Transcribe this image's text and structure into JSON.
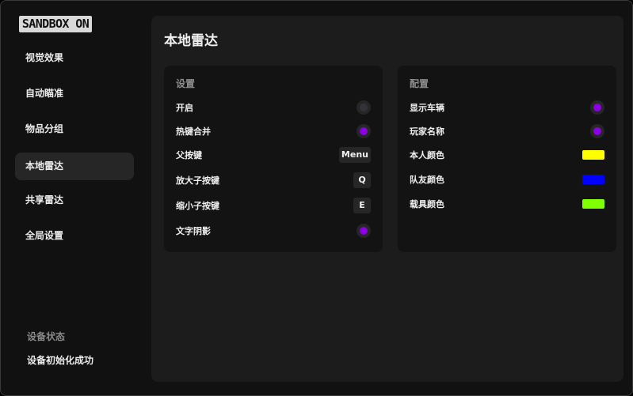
{
  "app": {
    "logo_text": "SANDBOX ON"
  },
  "sidebar": {
    "items": [
      {
        "label": "视觉效果",
        "active": false
      },
      {
        "label": "自动瞄准",
        "active": false
      },
      {
        "label": "物品分组",
        "active": false
      },
      {
        "label": "本地雷达",
        "active": true
      },
      {
        "label": "共享雷达",
        "active": false
      },
      {
        "label": "全局设置",
        "active": false
      }
    ],
    "status_heading": "设备状态",
    "status_text": "设备初始化成功"
  },
  "main": {
    "title": "本地雷达",
    "settings_panel": {
      "heading": "设置",
      "rows": [
        {
          "label": "开启",
          "control": "toggle",
          "value": false
        },
        {
          "label": "热键合并",
          "control": "toggle",
          "value": true
        },
        {
          "label": "父按键",
          "control": "key",
          "value": "Menu"
        },
        {
          "label": "放大子按键",
          "control": "key",
          "value": "Q"
        },
        {
          "label": "缩小子按键",
          "control": "key",
          "value": "E"
        },
        {
          "label": "文字阴影",
          "control": "toggle",
          "value": true
        }
      ]
    },
    "config_panel": {
      "heading": "配置",
      "rows": [
        {
          "label": "显示车辆",
          "control": "toggle",
          "value": true
        },
        {
          "label": "玩家名称",
          "control": "toggle",
          "value": true
        },
        {
          "label": "本人颜色",
          "control": "color",
          "value": "#ffff00"
        },
        {
          "label": "队友颜色",
          "control": "color",
          "value": "#0000ff"
        },
        {
          "label": "载具颜色",
          "control": "color",
          "value": "#80ff00"
        }
      ]
    }
  },
  "colors": {
    "accent": "#8b00e0",
    "background": "#111111",
    "panel": "#131313",
    "main": "#1c1c1c"
  }
}
